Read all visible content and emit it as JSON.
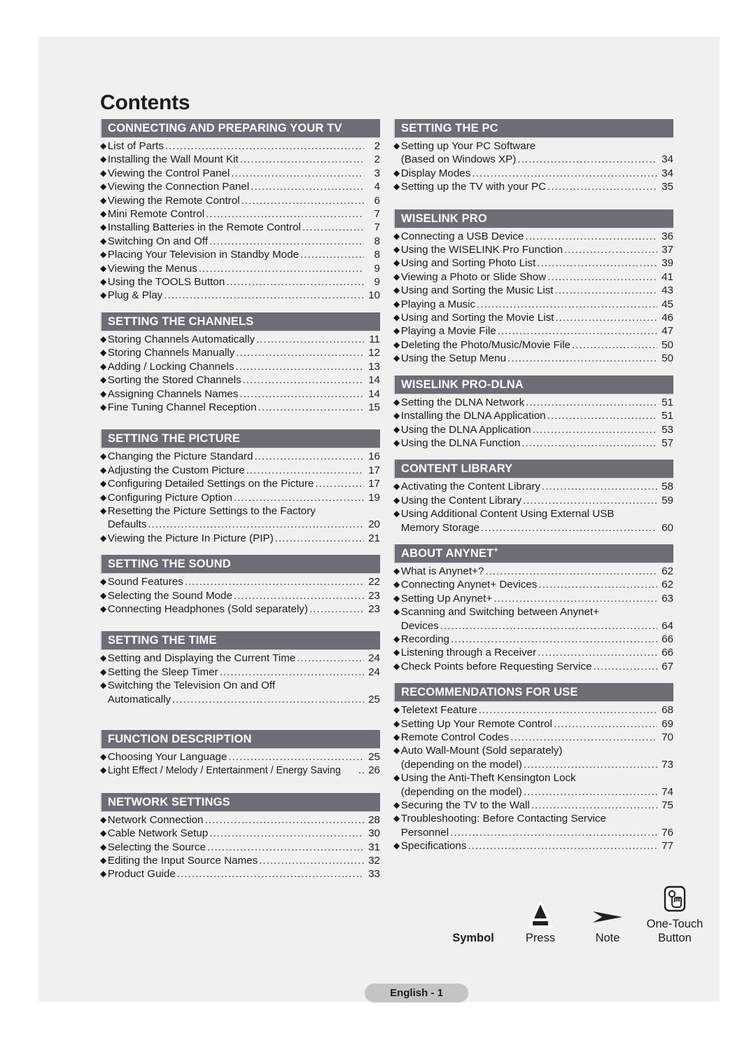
{
  "page": {
    "title": "Contents",
    "footer_label": "English - 1"
  },
  "left_column": [
    {
      "heading": "CONNECTING AND PREPARING YOUR TV",
      "items": [
        {
          "label": "List of Parts",
          "page": "2"
        },
        {
          "label": "Installing the Wall Mount Kit",
          "page": "2"
        },
        {
          "label": "Viewing the Control Panel",
          "page": "3"
        },
        {
          "label": "Viewing the Connection Panel",
          "page": "4"
        },
        {
          "label": "Viewing the Remote Control",
          "page": "6"
        },
        {
          "label": "Mini Remote Control",
          "page": "7"
        },
        {
          "label": "Installing Batteries in the Remote Control",
          "page": "7"
        },
        {
          "label": "Switching On and Off",
          "page": "8"
        },
        {
          "label": "Placing Your Television in Standby Mode",
          "page": "8"
        },
        {
          "label": "Viewing the Menus",
          "page": "9"
        },
        {
          "label": "Using the TOOLS Button",
          "page": "9"
        },
        {
          "label": "Plug & Play",
          "page": "10"
        }
      ]
    },
    {
      "heading": "SETTING THE CHANNELS",
      "items": [
        {
          "label": "Storing Channels Automatically",
          "page": "11"
        },
        {
          "label": "Storing Channels Manually",
          "page": "12"
        },
        {
          "label": "Adding / Locking Channels",
          "page": "13"
        },
        {
          "label": "Sorting the Stored Channels",
          "page": "14"
        },
        {
          "label": "Assigning Channels Names",
          "page": "14"
        },
        {
          "label": "Fine Tuning Channel Reception",
          "page": "15"
        }
      ]
    },
    {
      "heading": "SETTING THE PICTURE",
      "items": [
        {
          "label": "Changing the Picture Standard",
          "page": "16"
        },
        {
          "label": "Adjusting the Custom Picture",
          "page": "17"
        },
        {
          "label": "Configuring Detailed Settings on the Picture",
          "page": "17"
        },
        {
          "label": "Configuring Picture Option",
          "page": "19"
        },
        {
          "label": "Resetting the Picture Settings to the Factory",
          "page": "",
          "no_leader": true
        },
        {
          "label": "Defaults",
          "page": "20",
          "continuation": true
        },
        {
          "label": "Viewing the Picture In Picture (PIP)",
          "page": "21"
        }
      ]
    },
    {
      "heading": "SETTING THE SOUND",
      "items": [
        {
          "label": "Sound Features",
          "page": "22"
        },
        {
          "label": "Selecting the Sound Mode",
          "page": "23"
        },
        {
          "label": "Connecting Headphones (Sold separately)",
          "page": "23"
        }
      ]
    },
    {
      "heading": "SETTING THE TIME",
      "items": [
        {
          "label": "Setting and Displaying the Current Time",
          "page": "24"
        },
        {
          "label": "Setting the Sleep Timer",
          "page": "24"
        },
        {
          "label": "Switching the Television On and Off",
          "page": "",
          "no_leader": true
        },
        {
          "label": "Automatically",
          "page": "25",
          "continuation": true
        }
      ]
    },
    {
      "heading": "FUNCTION DESCRIPTION",
      "items": [
        {
          "label": "Choosing Your Language",
          "page": "25"
        },
        {
          "label": "Light Effect / Melody / Entertainment / Energy Saving",
          "page": "26",
          "condensed": true
        }
      ]
    },
    {
      "heading": "NETWORK SETTINGS",
      "items": [
        {
          "label": "Network Connection",
          "page": "28"
        },
        {
          "label": "Cable Network Setup",
          "page": "30"
        },
        {
          "label": "Selecting the Source",
          "page": "31"
        },
        {
          "label": "Editing the Input Source Names",
          "page": "32"
        },
        {
          "label": "Product Guide",
          "page": "33"
        }
      ]
    }
  ],
  "right_column": [
    {
      "heading": "SETTING THE PC",
      "items": [
        {
          "label": "Setting up Your PC Software",
          "page": "",
          "no_leader": true
        },
        {
          "label": "(Based on Windows XP)",
          "page": "34",
          "continuation": true
        },
        {
          "label": "Display Modes",
          "page": "34"
        },
        {
          "label": "Setting up the TV with your PC",
          "page": "35"
        }
      ]
    },
    {
      "heading": "WISELINK PRO",
      "items": [
        {
          "label": "Connecting a USB Device",
          "page": "36"
        },
        {
          "label": "Using the WISELINK Pro Function",
          "page": "37"
        },
        {
          "label": "Using and Sorting Photo List",
          "page": "39"
        },
        {
          "label": "Viewing a Photo or Slide Show",
          "page": "41"
        },
        {
          "label": "Using and Sorting the Music List",
          "page": "43"
        },
        {
          "label": "Playing a Music",
          "page": "45"
        },
        {
          "label": "Using and Sorting the Movie List",
          "page": "46"
        },
        {
          "label": "Playing a Movie File",
          "page": "47"
        },
        {
          "label": "Deleting the Photo/Music/Movie File",
          "page": "50"
        },
        {
          "label": "Using the Setup Menu",
          "page": "50"
        }
      ]
    },
    {
      "heading": "WISELINK PRO-DLNA",
      "items": [
        {
          "label": "Setting the DLNA Network",
          "page": "51"
        },
        {
          "label": "Installing the DLNA Application",
          "page": "51"
        },
        {
          "label": "Using the DLNA Application",
          "page": "53"
        },
        {
          "label": "Using the DLNA Function",
          "page": "57"
        }
      ]
    },
    {
      "heading": "CONTENT LIBRARY",
      "items": [
        {
          "label": "Activating the Content Library",
          "page": "58"
        },
        {
          "label": "Using the Content Library",
          "page": "59"
        },
        {
          "label": "Using Additional Content Using External USB",
          "page": "",
          "no_leader": true
        },
        {
          "label": "Memory Storage",
          "page": "60",
          "continuation": true
        }
      ]
    },
    {
      "heading": "ABOUT ANYNET",
      "heading_sup": "+",
      "items": [
        {
          "label": "What is Anynet+?",
          "page": "62"
        },
        {
          "label": "Connecting Anynet+ Devices",
          "page": "62"
        },
        {
          "label": "Setting Up Anynet+",
          "page": "63"
        },
        {
          "label": "Scanning and Switching between Anynet+",
          "page": "",
          "no_leader": true
        },
        {
          "label": "Devices",
          "page": "64",
          "continuation": true
        },
        {
          "label": "Recording",
          "page": "66"
        },
        {
          "label": "Listening through a Receiver",
          "page": "66"
        },
        {
          "label": "Check Points before Requesting Service",
          "page": "67"
        }
      ]
    },
    {
      "heading": "RECOMMENDATIONS FOR USE",
      "items": [
        {
          "label": "Teletext Feature",
          "page": "68"
        },
        {
          "label": "Setting Up Your Remote Control",
          "page": "69"
        },
        {
          "label": "Remote Control Codes",
          "page": "70"
        },
        {
          "label": "Auto Wall-Mount (Sold separately)",
          "page": "",
          "no_leader": true
        },
        {
          "label": "(depending on the model)",
          "page": "73",
          "continuation": true
        },
        {
          "label": "Using the Anti-Theft Kensington Lock",
          "page": "",
          "no_leader": true
        },
        {
          "label": "(depending on the model)",
          "page": "74",
          "continuation": true
        },
        {
          "label": "Securing the TV to the Wall",
          "page": "75"
        },
        {
          "label": "Troubleshooting: Before Contacting Service",
          "page": "",
          "no_leader": true
        },
        {
          "label": "Personnel",
          "page": "76",
          "continuation": true
        },
        {
          "label": "Specifications",
          "page": "77"
        }
      ]
    }
  ],
  "legend": [
    {
      "label": "Symbol",
      "icon": "none"
    },
    {
      "label": "Press",
      "icon": "press-triangle-icon"
    },
    {
      "label": "Note",
      "icon": "note-arrow-icon"
    },
    {
      "label": "One-Touch Button",
      "label_line1": "One-Touch",
      "label_line2": "Button",
      "icon": "one-touch-button-icon"
    }
  ],
  "colors": {
    "page_background": "#eff0ef",
    "section_header_bar": "#6d6d75",
    "section_header_text": "#ffffff",
    "text": "#1c1c1c",
    "footer_pill": "#c3c4c4"
  }
}
